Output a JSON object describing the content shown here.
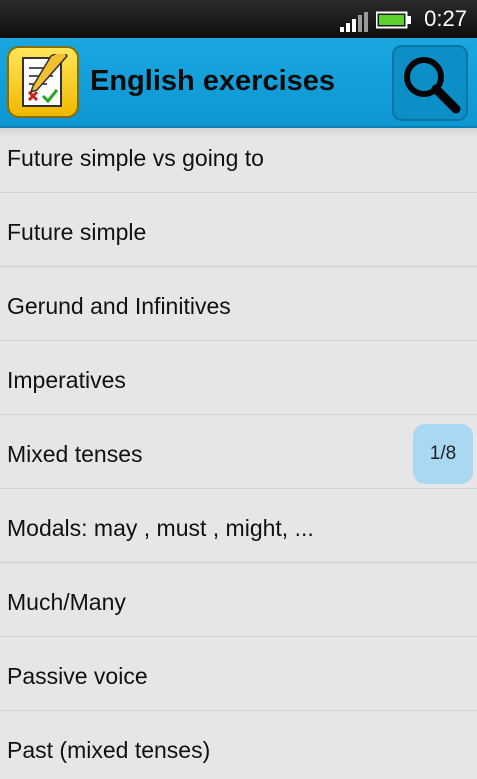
{
  "status_bar": {
    "time": "0:27",
    "signal_icon": "signal-bars-icon",
    "battery_icon": "battery-icon",
    "battery_color": "#5cd02c"
  },
  "action_bar": {
    "title": "English exercises",
    "app_icon": "checklist-pencil-icon",
    "search_icon": "search-icon",
    "background_color": "#10a0da"
  },
  "list": {
    "items": [
      {
        "label": "Future simple vs going to"
      },
      {
        "label": "Future simple"
      },
      {
        "label": "Gerund and Infinitives"
      },
      {
        "label": "Imperatives"
      },
      {
        "label": "Mixed tenses"
      },
      {
        "label": "Modals: may , must , might, ..."
      },
      {
        "label": "Much/Many"
      },
      {
        "label": "Passive voice"
      },
      {
        "label": "Past (mixed tenses)"
      }
    ]
  },
  "page_indicator": {
    "text": "1/8"
  }
}
